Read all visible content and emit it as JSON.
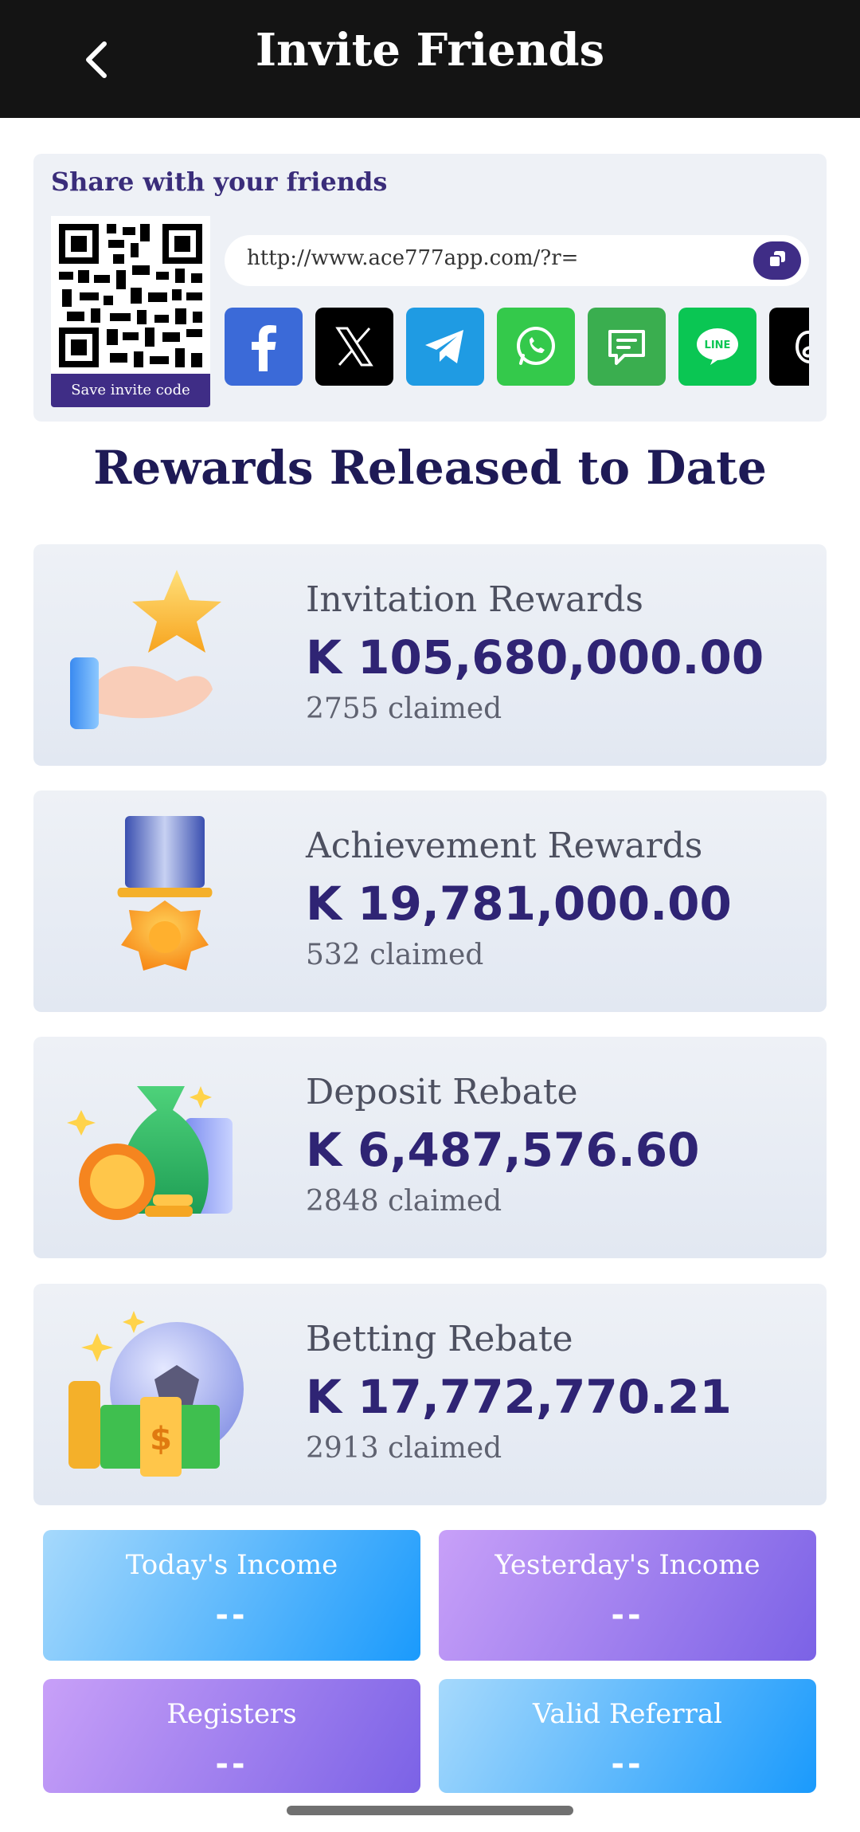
{
  "header": {
    "title": "Invite Friends"
  },
  "share": {
    "title": "Share with your friends",
    "save_label": "Save invite code",
    "url": "http://www.ace777app.com/?r=",
    "socials": [
      {
        "name": "facebook",
        "color": "#3b6ad8"
      },
      {
        "name": "x",
        "color": "#000000"
      },
      {
        "name": "telegram",
        "color": "#1f9be3"
      },
      {
        "name": "whatsapp",
        "color": "#34c94b"
      },
      {
        "name": "sms",
        "color": "#3aae4f"
      },
      {
        "name": "line",
        "color": "#0ac653"
      },
      {
        "name": "threads",
        "color": "#000000"
      }
    ]
  },
  "rewards_title": "Rewards Released to Date",
  "rewards": [
    {
      "name": "Invitation Rewards",
      "currency": "K",
      "amount": "105,680,000.00",
      "claimed": "2755 claimed",
      "icon": "hand-star-icon"
    },
    {
      "name": "Achievement Rewards",
      "currency": "K",
      "amount": "19,781,000.00",
      "claimed": "532 claimed",
      "icon": "medal-icon"
    },
    {
      "name": "Deposit Rebate",
      "currency": "K",
      "amount": "6,487,576.60",
      "claimed": "2848 claimed",
      "icon": "money-bag-icon"
    },
    {
      "name": "Betting Rebate",
      "currency": "K",
      "amount": "17,772,770.21",
      "claimed": "2913 claimed",
      "icon": "football-cash-icon"
    }
  ],
  "stats": [
    {
      "label": "Today's Income",
      "value": "--"
    },
    {
      "label": "Yesterday's Income",
      "value": "--"
    },
    {
      "label": "Registers",
      "value": "--"
    },
    {
      "label": "Valid Referral",
      "value": "--"
    }
  ]
}
